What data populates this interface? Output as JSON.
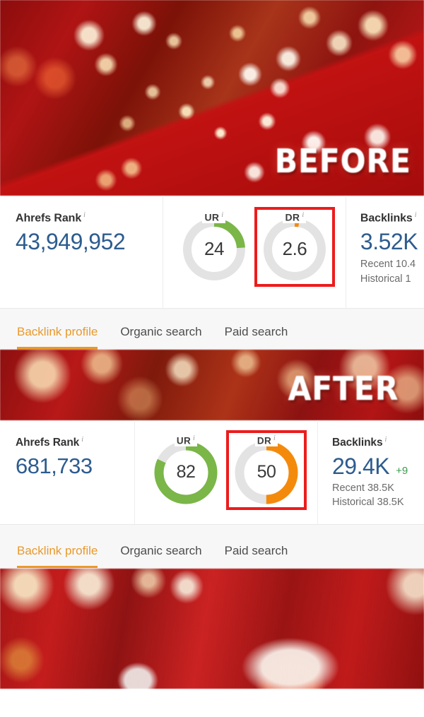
{
  "overlays": {
    "before_label": "BEFORE",
    "after_label": "AFTER"
  },
  "colors": {
    "accent_orange": "#e8992c",
    "highlight_red": "#ec1c1c",
    "value_blue": "#2d5c8f",
    "gauge_green": "#7ab648",
    "gauge_orange": "#f48a0c",
    "gauge_track": "#e3e3e3",
    "delta_green": "#3a9b4e"
  },
  "before": {
    "rank": {
      "label": "Ahrefs Rank",
      "info": "i",
      "value": "43,949,952"
    },
    "ur": {
      "label": "UR",
      "info": "i",
      "value": "24",
      "percent": 24,
      "color": "#7ab648",
      "highlighted": false
    },
    "dr": {
      "label": "DR",
      "info": "i",
      "value": "2.6",
      "percent": 2.6,
      "color": "#f48a0c",
      "highlighted": true
    },
    "backlinks": {
      "label": "Backlinks",
      "info": "i",
      "value": "3.52K",
      "delta": "",
      "recent": "Recent 10.4",
      "historical": "Historical 1"
    },
    "tabs": [
      {
        "label": "Backlink profile",
        "active": true
      },
      {
        "label": "Organic search",
        "active": false
      },
      {
        "label": "Paid search",
        "active": false
      }
    ]
  },
  "after": {
    "rank": {
      "label": "Ahrefs Rank",
      "info": "i",
      "value": "681,733"
    },
    "ur": {
      "label": "UR",
      "info": "i",
      "value": "82",
      "percent": 82,
      "color": "#7ab648",
      "highlighted": false
    },
    "dr": {
      "label": "DR",
      "info": "i",
      "value": "50",
      "percent": 50,
      "color": "#f48a0c",
      "highlighted": true
    },
    "backlinks": {
      "label": "Backlinks",
      "info": "i",
      "value": "29.4K",
      "delta": "+9",
      "recent": "Recent 38.5K",
      "historical": "Historical 38.5K"
    },
    "tabs": [
      {
        "label": "Backlink profile",
        "active": true
      },
      {
        "label": "Organic search",
        "active": false
      },
      {
        "label": "Paid search",
        "active": false
      }
    ]
  }
}
